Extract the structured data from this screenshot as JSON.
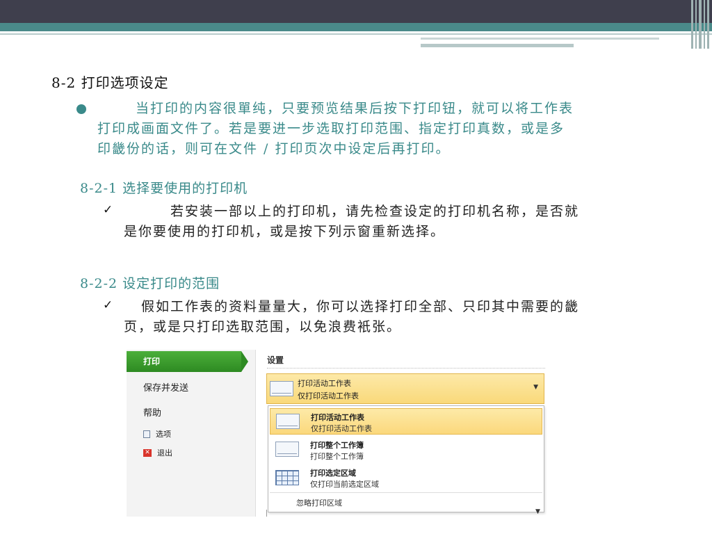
{
  "heading": "8-2 打印选项设定",
  "intro_lines": [
    "当打印的内容很單纯，只要预览结果后按下打印钮，就可以将工作表",
    "打印成画面文件了。若是要进一步选取打印范围、指定打印真数，或是多",
    "印畿份的话，则可在文件 / 打印页次中设定后再打印。"
  ],
  "section1": {
    "title": "8-2-1 选择要使用的打印机",
    "check": "✓",
    "lines": [
      "若安装一部以上的打印机，请先检查设定的打印机名称，是否就",
      "是你要使用的打印机，或是按下列示窗重新选择。"
    ]
  },
  "section2": {
    "title": "8-2-2 设定打印的范围",
    "check": "✓",
    "lines": [
      "假如工作表的资料量量大，你可以选择打印全部、只印其中需要的畿",
      "页，或是只打印选取范围，以免浪费衹张。"
    ]
  },
  "screenshot": {
    "sidebar": {
      "active": "打印",
      "items": [
        "保存并发送",
        "帮助"
      ],
      "options_label": "选项",
      "exit_label": "退出"
    },
    "settings_title": "设置",
    "dropdown": {
      "title": "打印活动工作表",
      "subtitle": "仅打印活动工作表"
    },
    "menu": [
      {
        "title": "打印活动工作表",
        "subtitle": "仅打印活动工作表"
      },
      {
        "title": "打印整个工作簿",
        "subtitle": "打印整个工作簿"
      },
      {
        "title": "打印选定区域",
        "subtitle": "仅打印当前选定区域"
      }
    ],
    "ignore_label": "忽略打印区域"
  },
  "colors": {
    "teal_text": "#3a8a8a",
    "top_bar": "#3f3f4d",
    "accent_teal": "#4a8a8a",
    "ribbon_green": "#2d8a22",
    "highlight_yellow": "#fbd87c"
  }
}
